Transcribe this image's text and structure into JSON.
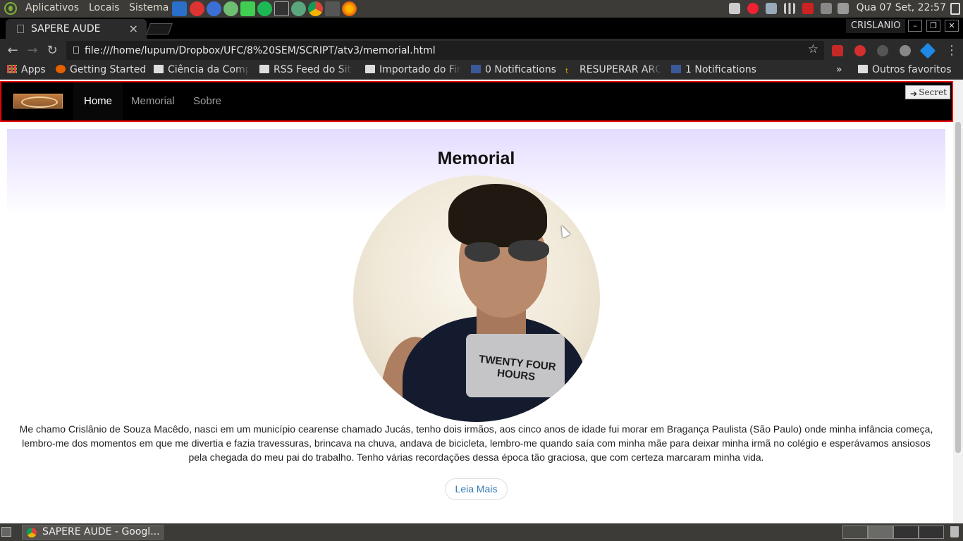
{
  "system_panel": {
    "menus": [
      "Aplicativos",
      "Locais",
      "Sistema"
    ],
    "clock": "Qua 07 Set, 22:57"
  },
  "browser": {
    "tab_title": "SAPERE AUDE",
    "tab_close": "×",
    "profile_name": "CRISLANIO",
    "url": "file:///home/lupum/Dropbox/UFC/8%20SEM/SCRIPT/atv3/memorial.html",
    "bookmarks": [
      {
        "label": "Apps",
        "icon": "apps-grid-icon"
      },
      {
        "label": "Getting Started",
        "icon": "firefox-icon"
      },
      {
        "label": "Ciência da Comp",
        "icon": "folder-icon"
      },
      {
        "label": "RSS Feed do Site",
        "icon": "folder-icon"
      },
      {
        "label": "Importado do Fir",
        "icon": "folder-icon"
      },
      {
        "label": "0 Notifications",
        "icon": "facebook-icon"
      },
      {
        "label": "RESUPERAR ARQ",
        "icon": "tumblr-icon"
      },
      {
        "label": "1 Notifications",
        "icon": "facebook-icon"
      }
    ],
    "bookmarks_overflow": "»",
    "other_bookmarks": "Outros favoritos"
  },
  "site": {
    "nav": {
      "items": [
        {
          "label": "Home",
          "active": true
        },
        {
          "label": "Memorial",
          "active": false
        },
        {
          "label": "Sobre",
          "active": false
        }
      ],
      "secret_button": "Secret"
    },
    "title": "Memorial",
    "portrait_print": "TWENTY FOUR HOURS",
    "bio": "Me chamo Crislânio de Souza Macêdo, nasci em um município cearense chamado Jucás, tenho dois irmãos, aos cinco anos de idade fui morar em Bragança Paulista (São Paulo) onde minha infância começa, lembro-me dos momentos em que me divertia e fazia travessuras, brincava na chuva, andava de bicicleta, lembro-me quando saía com minha mãe para deixar minha irmã no colégio e esperávamos ansiosos pela chegada do meu pai do trabalho. Tenho várias recordações dessa época tão graciosa, que com certeza marcaram minha vida.",
    "more_button": "Leia Mais"
  },
  "taskbar": {
    "window_title": "SAPERE AUDE - Googl..."
  },
  "colors": {
    "nav_border": "#ee0000",
    "link": "#337ab7",
    "panel": "#3c3b37"
  }
}
